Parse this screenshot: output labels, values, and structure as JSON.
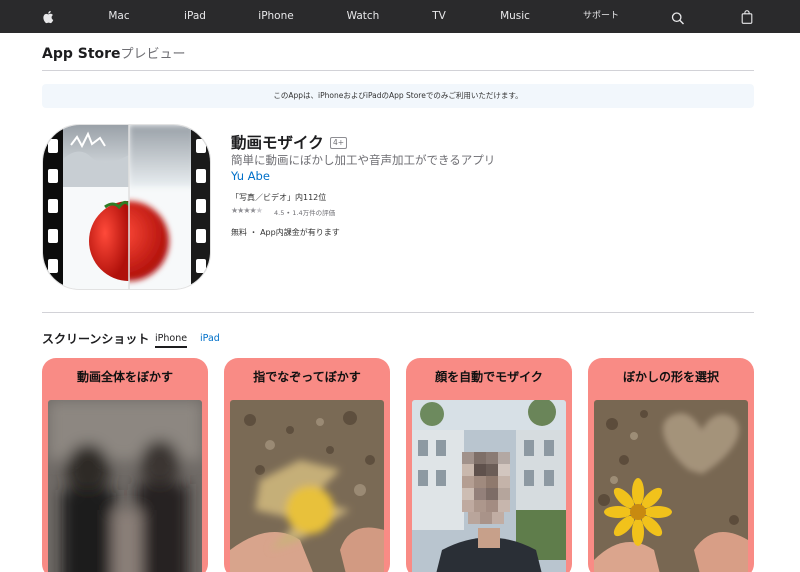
{
  "nav": {
    "items": [
      "Mac",
      "iPad",
      "iPhone",
      "Watch",
      "TV",
      "Music",
      "サポート"
    ],
    "icons": [
      "apple-logo-icon",
      "search-icon",
      "bag-icon"
    ]
  },
  "header": {
    "brand": "App Store",
    "suffix": "プレビュー"
  },
  "notice": "このAppは、iPhoneおよびiPadのApp Storeでのみご利用いただけます。",
  "app": {
    "title": "動画モザイク",
    "age_rating": "4+",
    "subtitle": "簡単に動画にぼかし加工や音声加工ができるアプリ",
    "developer": "Yu Abe",
    "rank": "「写真／ビデオ」内112位",
    "stars": 4.5,
    "rating_text": "4.5 • 1.4万件の評価",
    "price": "無料 ・ App内課金が有ります"
  },
  "screenshots": {
    "heading": "スクリーンショット",
    "tabs": [
      "iPhone",
      "iPad"
    ],
    "active_tab": "iPhone",
    "cards": [
      {
        "caption": "動画全体をぼかす"
      },
      {
        "caption": "指でなぞってぼかす"
      },
      {
        "caption": "顔を自動でモザイク"
      },
      {
        "caption": "ぼかしの形を選択"
      }
    ]
  },
  "colors": {
    "nav_bg": "#2a2a2c",
    "link": "#0070c9",
    "card_bg": "#f98b85",
    "notice_bg": "#f2f7fc"
  }
}
